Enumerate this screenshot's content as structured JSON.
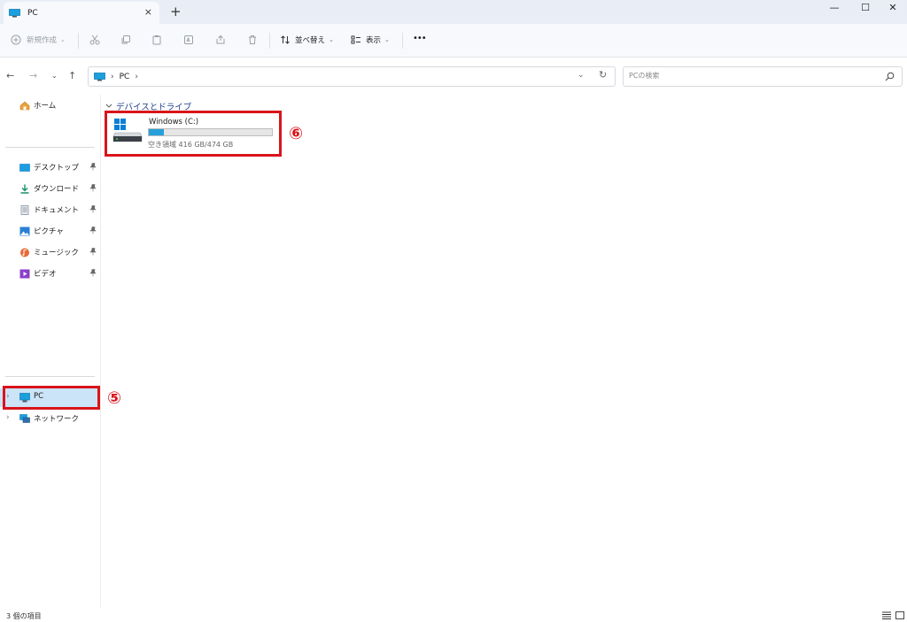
{
  "window": {
    "tab_title": "PC",
    "tab_close": "×",
    "new_tab": "+",
    "minimize": "—",
    "maximize": "☐",
    "close": "✕"
  },
  "toolbar": {
    "new_label": "新規作成",
    "sort_label": "並べ替え",
    "view_label": "表示",
    "more_label": "•••"
  },
  "address": {
    "path": "PC",
    "search_placeholder": "PCの検索"
  },
  "sidebar": {
    "home": "ホーム",
    "quick_access": [
      {
        "label": "デスクトップ",
        "icon": "desktop-icon"
      },
      {
        "label": "ダウンロード",
        "icon": "download-icon"
      },
      {
        "label": "ドキュメント",
        "icon": "document-icon"
      },
      {
        "label": "ピクチャ",
        "icon": "pictures-icon"
      },
      {
        "label": "ミュージック",
        "icon": "music-icon"
      },
      {
        "label": "ビデオ",
        "icon": "video-icon"
      }
    ],
    "pc": "PC",
    "network": "ネットワーク"
  },
  "content": {
    "group_header": "デバイスとドライブ",
    "drive": {
      "name": "Windows (C:)",
      "free_text": "空き領域 416 GB/474 GB",
      "used_fraction": 0.122
    }
  },
  "annotations": {
    "pc_number": "⑤",
    "drive_number": "⑥",
    "color": "#d9141b"
  },
  "status": {
    "item_count": "3 個の項目"
  },
  "colors": {
    "accent": "#26a0da",
    "selected_bg": "#cce4f7",
    "group_header": "#1f3f8f"
  }
}
